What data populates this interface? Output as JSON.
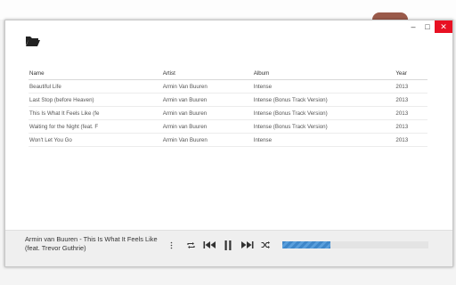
{
  "window": {
    "controls": [
      "–",
      "□",
      "✕"
    ]
  },
  "toolbar": {
    "open_icon": "folder-open-icon"
  },
  "table": {
    "headers": {
      "name": "Name",
      "artist": "Artist",
      "album": "Album",
      "year": "Year"
    },
    "rows": [
      {
        "name": "Beautiful Life",
        "artist": "Armin Van Buuren",
        "album": "Intense",
        "year": "2013"
      },
      {
        "name": "Last Stop (before Heaven)",
        "artist": "Armin van Buuren",
        "album": "Intense (Bonus Track Version)",
        "year": "2013"
      },
      {
        "name": "This Is What It Feels Like (fe",
        "artist": "Armin van Buuren",
        "album": "Intense (Bonus Track Version)",
        "year": "2013"
      },
      {
        "name": "Waiting for the Night (feat. F",
        "artist": "Armin van Buuren",
        "album": "Intense (Bonus Track Version)",
        "year": "2013"
      },
      {
        "name": "Won't Let You Go",
        "artist": "Armin Van Buuren",
        "album": "Intense",
        "year": "2013"
      }
    ]
  },
  "player": {
    "now_playing": "Armin van Buuren - This Is What It Feels Like (feat. Trevor Guthrie)",
    "progress": 0.33,
    "accent": "#3f87c9"
  }
}
